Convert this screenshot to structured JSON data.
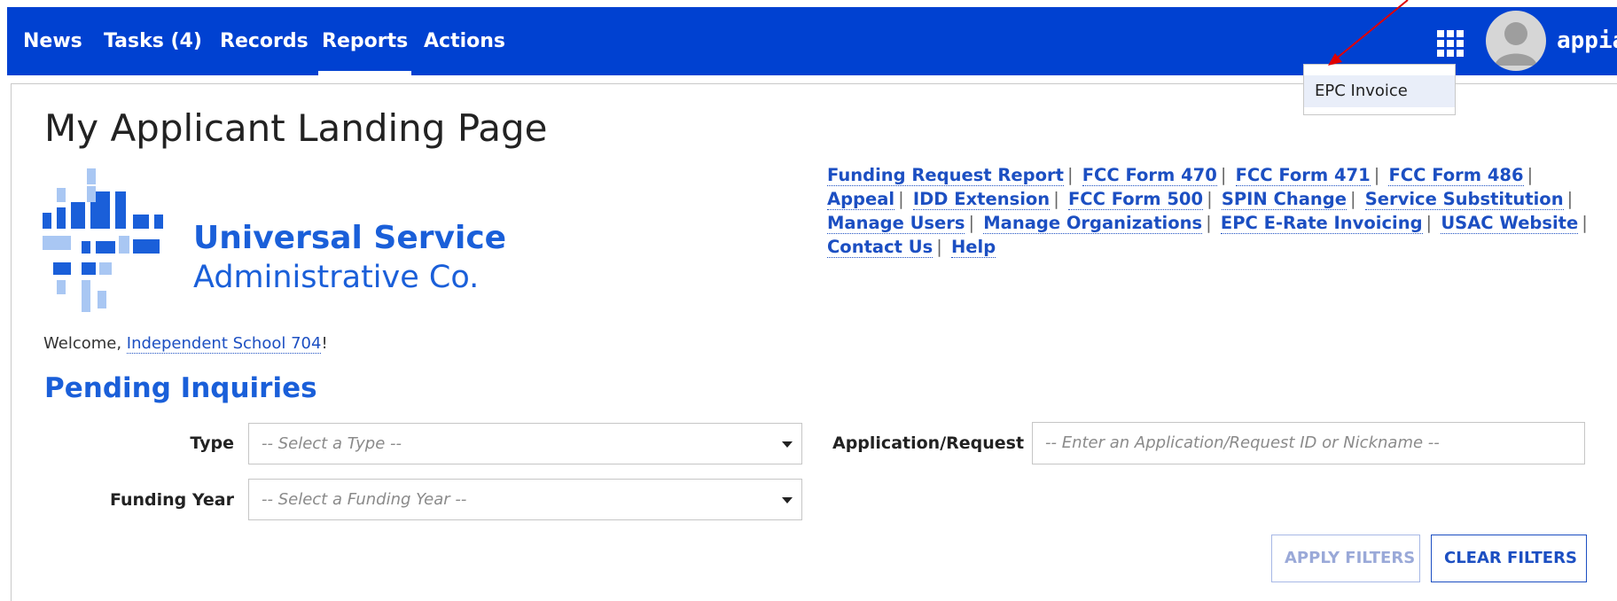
{
  "nav": {
    "items": [
      {
        "label": "News"
      },
      {
        "label": "Tasks (4)"
      },
      {
        "label": "Records"
      },
      {
        "label": "Reports"
      },
      {
        "label": "Actions"
      }
    ],
    "active": "Reports",
    "brand": "appian",
    "color": "#0041d1"
  },
  "dropdown": {
    "item": "EPC Invoice"
  },
  "page": {
    "title": "My Applicant Landing Page",
    "logo": {
      "line1": "Universal Service",
      "line2": "Administrative Co."
    },
    "welcome_prefix": "Welcome, ",
    "welcome_name": "Independent School 704",
    "welcome_suffix": "!"
  },
  "links": [
    "Funding Request Report",
    "FCC Form 470",
    "FCC Form 471",
    "FCC Form 486",
    "Appeal",
    "IDD Extension",
    "FCC Form 500",
    "SPIN Change",
    "Service Substitution",
    "Manage Users",
    "Manage Organizations",
    "EPC E-Rate Invoicing",
    "USAC Website",
    "Contact Us",
    "Help"
  ],
  "filters": {
    "section_title": "Pending Inquiries",
    "type_label": "Type",
    "type_placeholder": "-- Select a Type --",
    "year_label": "Funding Year",
    "year_placeholder": "-- Select a Funding Year --",
    "app_label": "Application/Request",
    "app_placeholder": "-- Enter an Application/Request ID or Nickname --",
    "apply_label": "APPLY FILTERS",
    "clear_label": "CLEAR FILTERS"
  },
  "icons": {
    "apps": "apps-grid-icon",
    "avatar": "user-avatar-icon"
  }
}
